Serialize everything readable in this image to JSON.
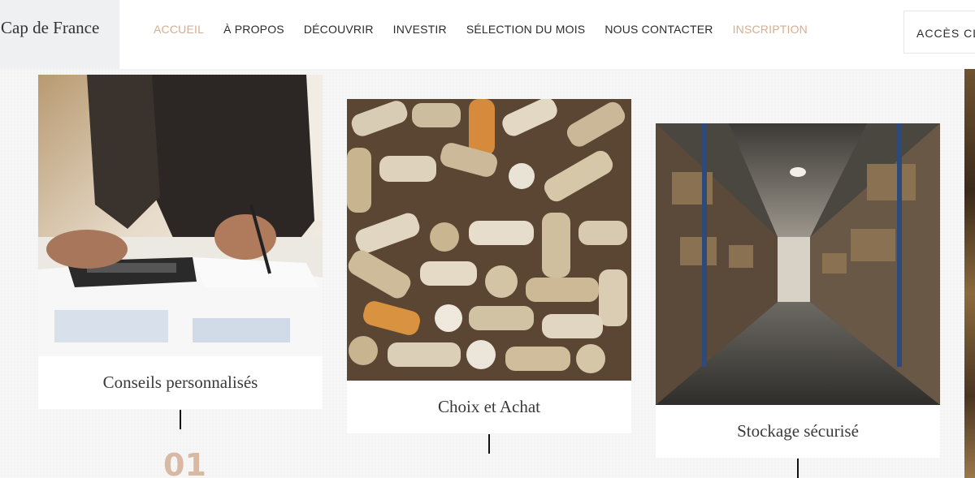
{
  "header": {
    "logo": "Cap de France",
    "nav": [
      {
        "label": "ACCUEIL",
        "active": true
      },
      {
        "label": "À PROPOS"
      },
      {
        "label": "DÉCOUVRIR"
      },
      {
        "label": "INVESTIR"
      },
      {
        "label": "SÉLECTION DU MOIS"
      },
      {
        "label": "NOUS CONTACTER"
      },
      {
        "label": "INSCRIPTION",
        "accent": true
      }
    ],
    "client_button": "ACCÈS CL"
  },
  "colors": {
    "accent": "#d5ae90",
    "step_number": "#d8b9a3",
    "text_dark": "#2b2b2b"
  },
  "cards": [
    {
      "caption": "Conseils personnalisés",
      "image": "business-calculator-photo"
    },
    {
      "caption": "Choix et Achat",
      "image": "wine-corks-photo"
    },
    {
      "caption": "Stockage sécurisé",
      "image": "warehouse-photo"
    }
  ],
  "steps": {
    "first": "01"
  }
}
